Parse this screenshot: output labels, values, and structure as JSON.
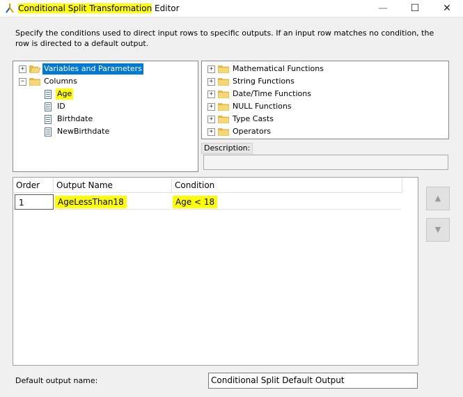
{
  "window": {
    "title_highlighted": "Conditional Split Transformation",
    "title_rest": " Editor",
    "minimize": "—",
    "maximize": "☐",
    "close": "✕"
  },
  "description": "Specify the conditions used to direct input rows to specific outputs. If an input row matches no condition, the row is directed to a default output.",
  "left_tree": {
    "variables_label": "Variables and Parameters",
    "columns_label": "Columns",
    "columns": [
      "Age",
      "ID",
      "Birthdate",
      "NewBirthdate"
    ]
  },
  "right_tree": {
    "items": [
      "Mathematical Functions",
      "String Functions",
      "Date/Time Functions",
      "NULL Functions",
      "Type Casts",
      "Operators"
    ]
  },
  "description_box": {
    "label": "Description:",
    "value": ""
  },
  "grid": {
    "headers": {
      "order": "Order",
      "output_name": "Output Name",
      "condition": "Condition"
    },
    "rows": [
      {
        "order": "1",
        "output_name": "AgeLessThan18",
        "condition": "Age < 18"
      }
    ]
  },
  "buttons": {
    "move_up": "▲",
    "move_down": "▼"
  },
  "default_output": {
    "label": "Default output name:",
    "value": "Conditional Split Default Output"
  },
  "colors": {
    "highlight": "#ffff00",
    "selection": "#0078d7"
  }
}
